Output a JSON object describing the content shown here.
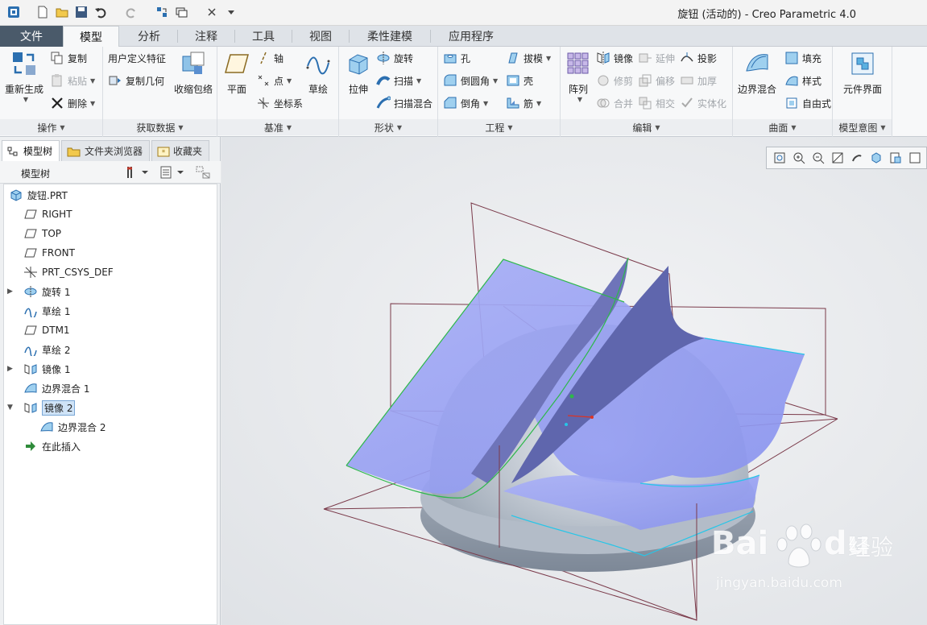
{
  "title": "旋钮 (活动的) - Creo Parametric 4.0",
  "tabs": [
    "文件",
    "模型",
    "分析",
    "注释",
    "工具",
    "视图",
    "柔性建模",
    "应用程序"
  ],
  "ribbon": {
    "ops": {
      "label": "操作",
      "regen": "重新生成",
      "copy": "复制",
      "paste": "粘贴",
      "delete": "删除"
    },
    "getdata": {
      "label": "获取数据",
      "udf": "用户定义特征",
      "copygeom": "复制几何",
      "shrinkwrap": "收缩包络"
    },
    "datum": {
      "label": "基准",
      "plane": "平面",
      "axis": "轴",
      "point": "点",
      "csys": "坐标系",
      "sketch": "草绘"
    },
    "shape": {
      "label": "形状",
      "extrude": "拉伸",
      "revolve": "旋转",
      "sweep": "扫描",
      "sweepblend": "扫描混合"
    },
    "eng": {
      "label": "工程",
      "hole": "孔",
      "round": "倒圆角",
      "chamfer": "倒角",
      "draft": "拔模",
      "shell": "壳",
      "rib": "筋"
    },
    "edit": {
      "label": "编辑",
      "pattern": "阵列",
      "mirror": "镜像",
      "extend": "延伸",
      "project": "投影",
      "trim": "修剪",
      "offset": "偏移",
      "thicken": "加厚",
      "merge": "合并",
      "intersect": "相交",
      "solidify": "实体化"
    },
    "surface": {
      "label": "曲面",
      "boundary": "边界混合",
      "fill": "填充",
      "style": "样式",
      "freestyle": "自由式"
    },
    "intent": {
      "label": "模型意图",
      "component": "元件界面"
    }
  },
  "panel": {
    "tabs": [
      "模型树",
      "文件夹浏览器",
      "收藏夹"
    ],
    "tree_title": "模型树"
  },
  "tree": [
    {
      "label": "旋钮.PRT",
      "icon": "part-icon"
    },
    {
      "label": "RIGHT",
      "icon": "datum-plane-icon"
    },
    {
      "label": "TOP",
      "icon": "datum-plane-icon"
    },
    {
      "label": "FRONT",
      "icon": "datum-plane-icon"
    },
    {
      "label": "PRT_CSYS_DEF",
      "icon": "csys-icon"
    },
    {
      "label": "旋转 1",
      "icon": "revolve-icon"
    },
    {
      "label": "草绘 1",
      "icon": "sketch-icon"
    },
    {
      "label": "DTM1",
      "icon": "datum-plane-icon"
    },
    {
      "label": "草绘 2",
      "icon": "sketch-icon"
    },
    {
      "label": "镜像 1",
      "icon": "mirror-icon"
    },
    {
      "label": "边界混合 1",
      "icon": "boundary-blend-icon"
    },
    {
      "label": "镜像 2",
      "icon": "mirror-icon"
    },
    {
      "label": "边界混合 2",
      "icon": "boundary-blend-icon"
    },
    {
      "label": "在此插入",
      "icon": "insert-here-icon"
    }
  ],
  "watermark": {
    "brand": "Bai",
    "brand2": "du",
    "cn": "经验",
    "url": "jingyan.baidu.com"
  },
  "colors": {
    "surface": "#8c95f0",
    "solid": "#9aa5b3",
    "datum": "#7a3a4a",
    "edge_green": "#2db84a",
    "edge_cyan": "#26c6e8"
  }
}
